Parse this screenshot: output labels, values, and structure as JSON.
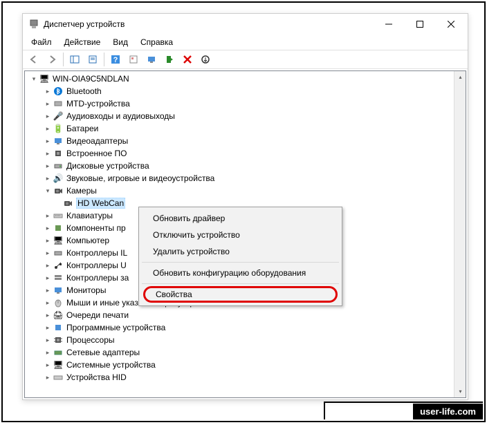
{
  "window": {
    "title": "Диспетчер устройств"
  },
  "menubar": {
    "file": "Файл",
    "action": "Действие",
    "view": "Вид",
    "help": "Справка"
  },
  "tree": {
    "root": "WIN-OIA9C5NDLAN",
    "bluetooth": "Bluetooth",
    "mtd": "MTD-устройства",
    "audio": "Аудиовходы и аудиовыходы",
    "battery": "Батареи",
    "video": "Видеоадаптеры",
    "firmware": "Встроенное ПО",
    "disk": "Дисковые устройства",
    "sound": "Звуковые, игровые и видеоустройства",
    "cameras": "Камеры",
    "camera_device": "HD WebCan",
    "keyboard": "Клавиатуры",
    "software_components": "Компоненты пр",
    "computer": "Компьютер",
    "ide": "Контроллеры IL",
    "usb": "Контроллеры U",
    "storage": "Контроллеры за",
    "monitors": "Мониторы",
    "mice": "Мыши и иные указывающие устройства",
    "printqueue": "Очереди печати",
    "software_devices": "Программные устройства",
    "processors": "Процессоры",
    "network": "Сетевые адаптеры",
    "system": "Системные устройства",
    "hid": "Устройства HID"
  },
  "context": {
    "update_driver": "Обновить драйвер",
    "disable": "Отключить устройство",
    "uninstall": "Удалить устройство",
    "scan": "Обновить конфигурацию оборудования",
    "properties": "Свойства"
  },
  "watermark": "user-life.com"
}
